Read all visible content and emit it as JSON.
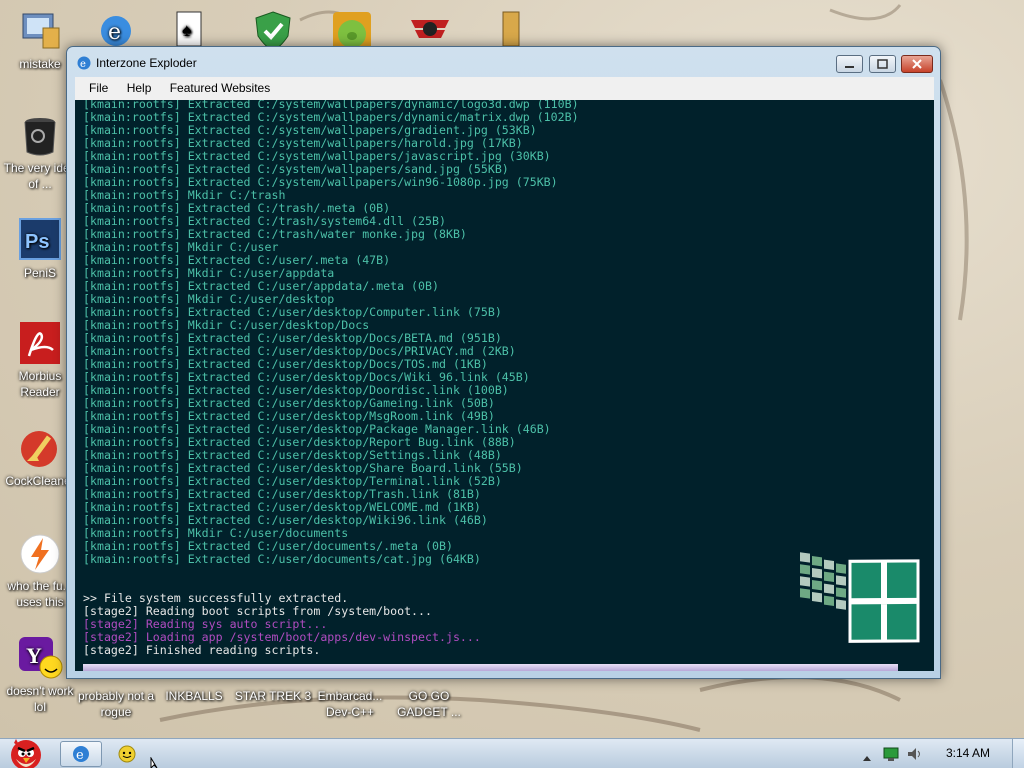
{
  "desktop": {
    "icons": [
      {
        "label": "mistake"
      },
      {
        "label": "The very idea of ..."
      },
      {
        "label": "PeniS"
      },
      {
        "label": "Morbius Reader"
      },
      {
        "label": "CockCleaner"
      },
      {
        "label": "who the fu... uses this"
      },
      {
        "label": "doesn't work lol"
      },
      {
        "label": "probably not a rogue"
      },
      {
        "label": "INKBALLS"
      },
      {
        "label": "STAR TREK 3"
      },
      {
        "label": "Embarcad... Dev-C++"
      },
      {
        "label": "GO GO GADGET ..."
      }
    ]
  },
  "window": {
    "title": "Interzone Exploder",
    "menu": [
      "File",
      "Help",
      "Featured Websites"
    ]
  },
  "console": {
    "lines": [
      {
        "text": "[kmain:rootfs] Extracted C:/system/wallpapers/dynamic/logo3d.dwp (110B)",
        "color": "teal"
      },
      {
        "text": "[kmain:rootfs] Extracted C:/system/wallpapers/dynamic/matrix.dwp (102B)",
        "color": "teal"
      },
      {
        "text": "[kmain:rootfs] Extracted C:/system/wallpapers/gradient.jpg (53KB)",
        "color": "teal"
      },
      {
        "text": "[kmain:rootfs] Extracted C:/system/wallpapers/harold.jpg (17KB)",
        "color": "teal"
      },
      {
        "text": "[kmain:rootfs] Extracted C:/system/wallpapers/javascript.jpg (30KB)",
        "color": "teal"
      },
      {
        "text": "[kmain:rootfs] Extracted C:/system/wallpapers/sand.jpg (55KB)",
        "color": "teal"
      },
      {
        "text": "[kmain:rootfs] Extracted C:/system/wallpapers/win96-1080p.jpg (75KB)",
        "color": "teal"
      },
      {
        "text": "[kmain:rootfs] Mkdir C:/trash",
        "color": "teal"
      },
      {
        "text": "[kmain:rootfs] Extracted C:/trash/.meta (0B)",
        "color": "teal"
      },
      {
        "text": "[kmain:rootfs] Extracted C:/trash/system64.dll (25B)",
        "color": "teal"
      },
      {
        "text": "[kmain:rootfs] Extracted C:/trash/water monke.jpg (8KB)",
        "color": "teal"
      },
      {
        "text": "[kmain:rootfs] Mkdir C:/user",
        "color": "teal"
      },
      {
        "text": "[kmain:rootfs] Extracted C:/user/.meta (47B)",
        "color": "teal"
      },
      {
        "text": "[kmain:rootfs] Mkdir C:/user/appdata",
        "color": "teal"
      },
      {
        "text": "[kmain:rootfs] Extracted C:/user/appdata/.meta (0B)",
        "color": "teal"
      },
      {
        "text": "[kmain:rootfs] Mkdir C:/user/desktop",
        "color": "teal"
      },
      {
        "text": "[kmain:rootfs] Extracted C:/user/desktop/Computer.link (75B)",
        "color": "teal"
      },
      {
        "text": "[kmain:rootfs] Mkdir C:/user/desktop/Docs",
        "color": "teal"
      },
      {
        "text": "[kmain:rootfs] Extracted C:/user/desktop/Docs/BETA.md (951B)",
        "color": "teal"
      },
      {
        "text": "[kmain:rootfs] Extracted C:/user/desktop/Docs/PRIVACY.md (2KB)",
        "color": "teal"
      },
      {
        "text": "[kmain:rootfs] Extracted C:/user/desktop/Docs/TOS.md (1KB)",
        "color": "teal"
      },
      {
        "text": "[kmain:rootfs] Extracted C:/user/desktop/Docs/Wiki 96.link (45B)",
        "color": "teal"
      },
      {
        "text": "[kmain:rootfs] Extracted C:/user/desktop/Doordisc.link (100B)",
        "color": "teal"
      },
      {
        "text": "[kmain:rootfs] Extracted C:/user/desktop/Gameing.link (50B)",
        "color": "teal"
      },
      {
        "text": "[kmain:rootfs] Extracted C:/user/desktop/MsgRoom.link (49B)",
        "color": "teal"
      },
      {
        "text": "[kmain:rootfs] Extracted C:/user/desktop/Package Manager.link (46B)",
        "color": "teal"
      },
      {
        "text": "[kmain:rootfs] Extracted C:/user/desktop/Report Bug.link (88B)",
        "color": "teal"
      },
      {
        "text": "[kmain:rootfs] Extracted C:/user/desktop/Settings.link (48B)",
        "color": "teal"
      },
      {
        "text": "[kmain:rootfs] Extracted C:/user/desktop/Share Board.link (55B)",
        "color": "teal"
      },
      {
        "text": "[kmain:rootfs] Extracted C:/user/desktop/Terminal.link (52B)",
        "color": "teal"
      },
      {
        "text": "[kmain:rootfs] Extracted C:/user/desktop/Trash.link (81B)",
        "color": "teal"
      },
      {
        "text": "[kmain:rootfs] Extracted C:/user/desktop/WELCOME.md (1KB)",
        "color": "teal"
      },
      {
        "text": "[kmain:rootfs] Extracted C:/user/desktop/Wiki96.link (46B)",
        "color": "teal"
      },
      {
        "text": "[kmain:rootfs] Mkdir C:/user/documents",
        "color": "teal"
      },
      {
        "text": "[kmain:rootfs] Extracted C:/user/documents/.meta (0B)",
        "color": "teal"
      },
      {
        "text": "[kmain:rootfs] Extracted C:/user/documents/cat.jpg (64KB)",
        "color": "teal"
      },
      {
        "text": "",
        "color": "white"
      },
      {
        "text": "",
        "color": "white"
      },
      {
        "text": ">> File system successfully extracted.",
        "color": "white"
      },
      {
        "text": "[stage2] Reading boot scripts from /system/boot...",
        "color": "white"
      },
      {
        "text": "[stage2] Reading sys auto script...",
        "color": "purple"
      },
      {
        "text": "[stage2] Loading app /system/boot/apps/dev-winspect.js...",
        "color": "purple"
      },
      {
        "text": "[stage2] Finished reading scripts.",
        "color": "white"
      }
    ]
  },
  "taskbar": {
    "clock": "3:14 AM"
  }
}
